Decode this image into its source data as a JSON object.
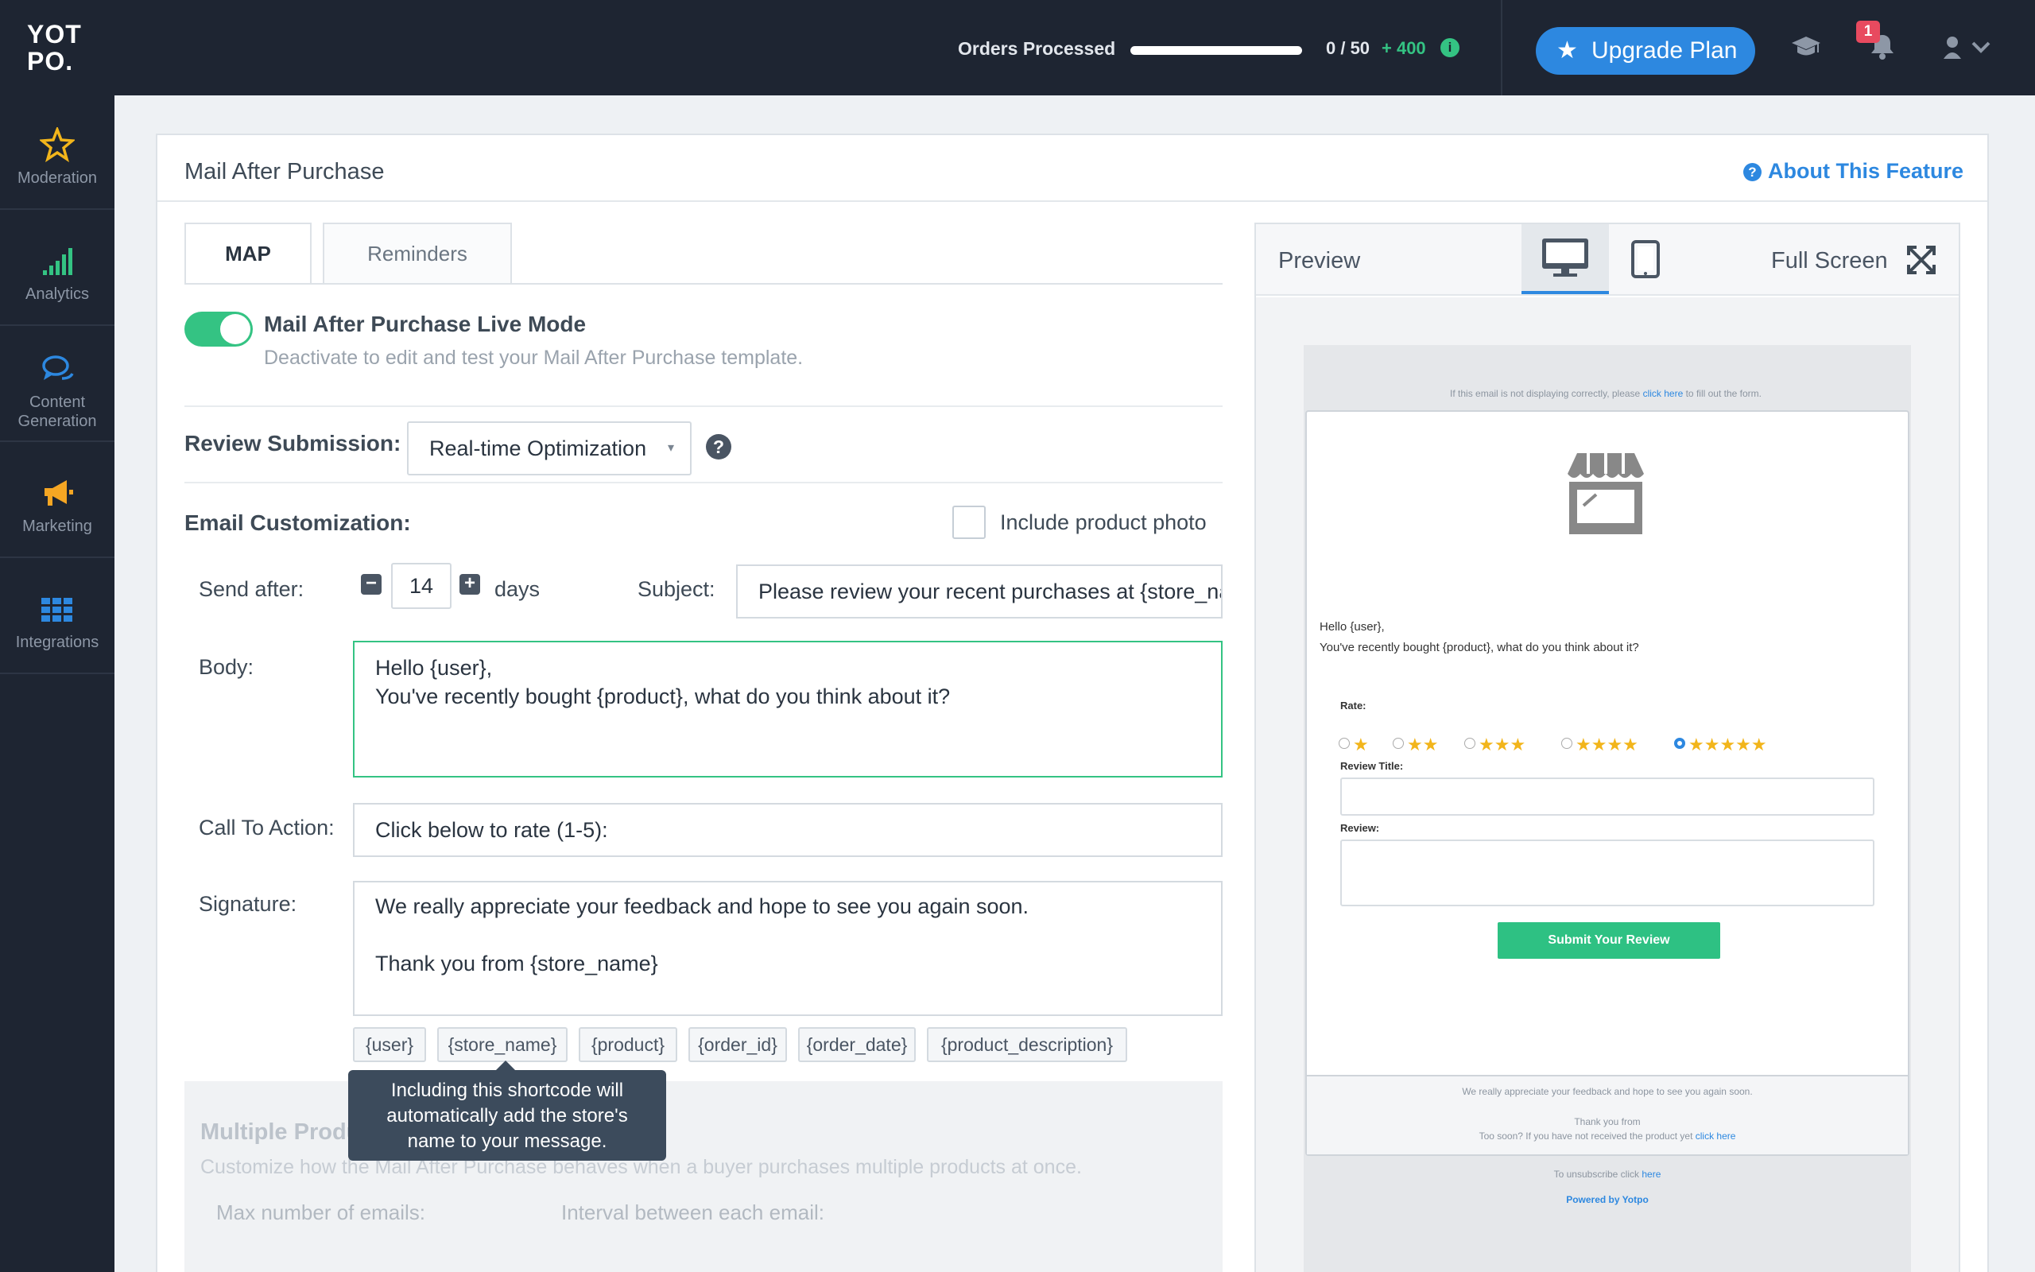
{
  "brand": {
    "logo": "YOT\nPO."
  },
  "top": {
    "orders_label": "Orders Processed",
    "orders_progress": 0,
    "orders_count": "0 / 50",
    "orders_plus": "+ 400",
    "info": "i",
    "upgrade": "Upgrade Plan",
    "notif_count": "1"
  },
  "sidebar": {
    "items": [
      {
        "label": "Moderation",
        "icon": "star-icon"
      },
      {
        "label": "Analytics",
        "icon": "bar-chart-icon"
      },
      {
        "label": "Content\nGeneration",
        "icon": "chat-icon"
      },
      {
        "label": "Marketing",
        "icon": "megaphone-icon"
      },
      {
        "label": "Integrations",
        "icon": "grid-icon"
      }
    ]
  },
  "page": {
    "title": "Mail After Purchase",
    "about": "About This Feature",
    "about_icon": "?"
  },
  "tabs": {
    "map": "MAP",
    "reminders": "Reminders"
  },
  "live": {
    "title": "Mail After Purchase Live Mode",
    "subtitle": "Deactivate to edit and test your Mail After Purchase template.",
    "enabled": true
  },
  "review": {
    "label": "Review Submission:",
    "selected": "Real-time Optimization",
    "arrow": "▾",
    "help": "?"
  },
  "email": {
    "label": "Email Customization:",
    "include_photo": "Include product photo",
    "include_photo_checked": false,
    "send_after_label": "Send after:",
    "minus": "−",
    "plus": "+",
    "days_value": "14",
    "days": "days",
    "subject_label": "Subject:",
    "subject": "Please review your recent purchases at {store_name}",
    "body_label": "Body:",
    "body_line1": "Hello {user},",
    "body_line2": "You've recently bought {product}, what do you think about it?",
    "cta_label": "Call To Action:",
    "cta": "Click below to rate (1-5):",
    "sig_label": "Signature:",
    "sig_line1": "We really appreciate your feedback and hope to see you again soon.",
    "sig_line2": "Thank you from {store_name}"
  },
  "chips": [
    "{user}",
    "{store_name}",
    "{product}",
    "{order_id}",
    "{order_date}",
    "{product_description}"
  ],
  "tooltip": {
    "line1": "Including this shortcode will",
    "line2": "automatically add the store's",
    "line3": "name to your message."
  },
  "multi": {
    "title": "Multiple Products",
    "subtitle": "Customize how the Mail After Purchase behaves when a buyer purchases multiple products at once.",
    "max_label": "Max number of emails:",
    "interval_label": "Interval between each email:"
  },
  "preview": {
    "label": "Preview",
    "full": "Full Screen",
    "email": {
      "top_pre": "If this email is not displaying correctly, please ",
      "top_link": "click here",
      "top_post": " to fill out the form.",
      "hello": "Hello {user},",
      "line": "You've recently bought {product}, what do you think about it?",
      "rate": "Rate:",
      "stars1": "★",
      "stars2": "★★",
      "stars3": "★★★",
      "stars4": "★★★★",
      "stars5": "★★★★★",
      "review_title": "Review Title:",
      "review": "Review:",
      "submit": "Submit Your Review",
      "footer1": "We really appreciate your feedback and hope to see you again soon.",
      "footer2": "Thank you from",
      "footer3_pre": "Too soon? If you have not received the product yet ",
      "footer3_link": "click here",
      "unsub_pre": "To unsubscribe click ",
      "unsub_link": "here",
      "powered": "Powered by Yotpo"
    }
  },
  "colors": {
    "nav_bg": "#1e2532",
    "accent": "#2d88e0",
    "green": "#34c383",
    "star": "#f2b51b"
  }
}
